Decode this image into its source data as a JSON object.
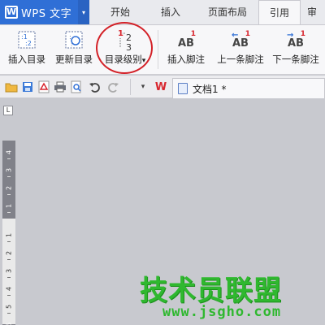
{
  "app": {
    "title": "WPS 文字",
    "logo_text": "W",
    "menu_caret": "▾"
  },
  "tabs": [
    {
      "label": "开始",
      "active": false
    },
    {
      "label": "插入",
      "active": false
    },
    {
      "label": "页面布局",
      "active": false
    },
    {
      "label": "引用",
      "active": true
    },
    {
      "label": "审",
      "active": false
    }
  ],
  "ribbon": {
    "buttons": [
      {
        "label": "插入目录",
        "icon": "insert-toc-icon"
      },
      {
        "label": "更新目录",
        "icon": "update-toc-icon"
      },
      {
        "label": "目录级别",
        "icon": "toc-level-icon",
        "dropdown": "▾"
      },
      {
        "label": "插入脚注",
        "icon": "insert-footnote-icon"
      },
      {
        "label": "上一条脚注",
        "icon": "prev-footnote-icon"
      },
      {
        "label": "下一条脚注",
        "icon": "next-footnote-icon"
      }
    ],
    "icon_glyphs": {
      "toc_level": [
        "1",
        "2",
        "3"
      ],
      "ab": "AB",
      "footnote_mark": "1",
      "arrow_left": "←",
      "arrow_right": "→"
    }
  },
  "quickbar": {
    "document_tab": "文档1 *",
    "wps_logo": "W"
  },
  "ruler": {
    "upper_numbers": [
      "4",
      "3",
      "2",
      "1"
    ],
    "lower_numbers": [
      "1",
      "2",
      "3",
      "4",
      "5",
      "6"
    ],
    "corner_mark": "L"
  },
  "watermark": {
    "chinese": "技术员联盟",
    "url": "www.jsgho.com"
  },
  "colors": {
    "brand_blue": "#2f6fd6",
    "annotation_red": "#d32027",
    "watermark_green": "#2fb82f"
  }
}
